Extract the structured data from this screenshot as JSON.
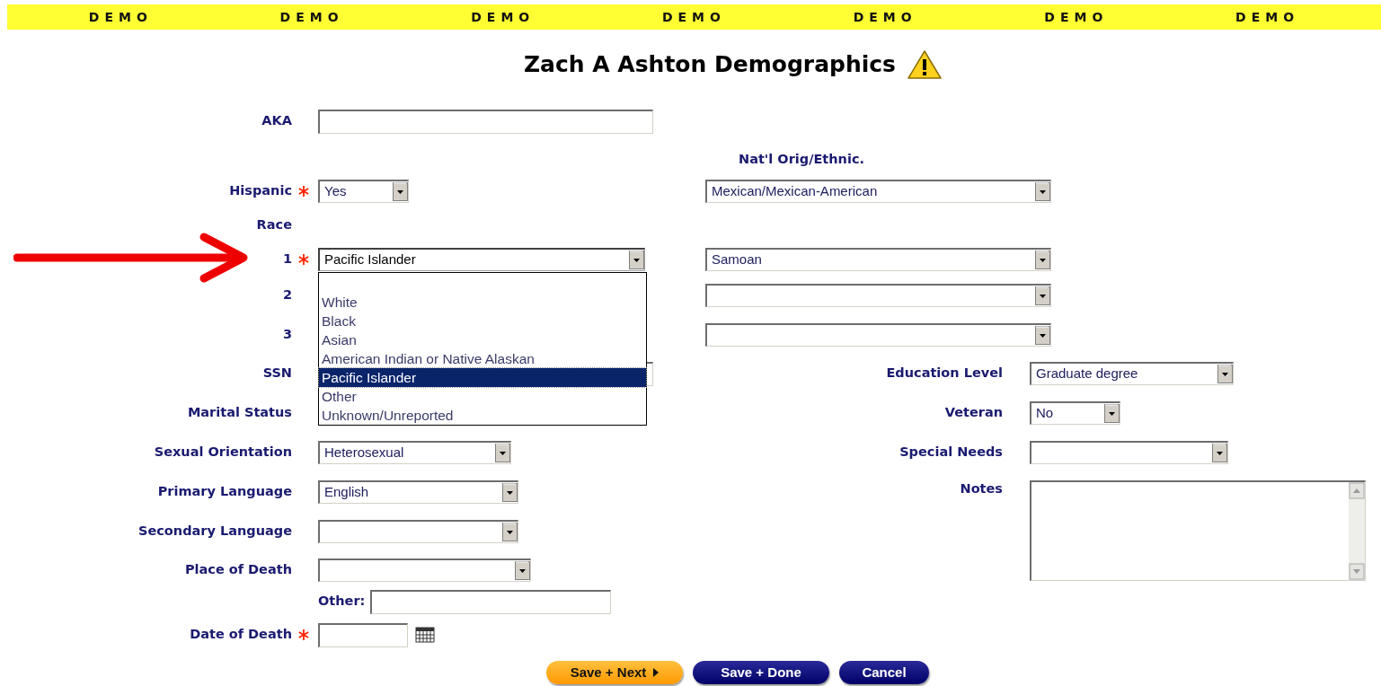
{
  "banner": [
    "DEMO",
    "DEMO",
    "DEMO",
    "DEMO",
    "DEMO",
    "DEMO",
    "DEMO"
  ],
  "title": "Zach A Ashton Demographics",
  "aka": {
    "label": "AKA"
  },
  "ethnicity_heading": "Nat'l Orig/Ethnic.",
  "hispanic": {
    "label": "Hispanic",
    "required": true,
    "value": "Yes",
    "ethnicity": "Mexican/Mexican-American"
  },
  "race": {
    "label": "Race",
    "rows": [
      {
        "number": "1",
        "required": true,
        "value": "Pacific Islander",
        "ethnicity": "Samoan",
        "expanded": true
      },
      {
        "number": "2",
        "required": false
      },
      {
        "number": "3",
        "required": false
      }
    ]
  },
  "race_options": [
    {
      "label": "White",
      "selected": false
    },
    {
      "label": "Black",
      "selected": false
    },
    {
      "label": "Asian",
      "selected": false
    },
    {
      "label": "American Indian or Native Alaskan",
      "selected": false
    },
    {
      "label": "Pacific Islander",
      "selected": true
    },
    {
      "label": "Other",
      "selected": false
    },
    {
      "label": "Unknown/Unreported",
      "selected": false
    }
  ],
  "left_fields": [
    {
      "label": "SSN",
      "kind": "text"
    },
    {
      "label": "Marital Status",
      "kind": "label"
    },
    {
      "label": "Sexual Orientation",
      "kind": "select",
      "value": "Heterosexual"
    },
    {
      "label": "Primary Language",
      "kind": "select",
      "value": "English"
    },
    {
      "label": "Secondary Language",
      "kind": "select"
    },
    {
      "label": "Place of Death",
      "kind": "select"
    },
    {
      "label": "Other:",
      "kind": "inline_text"
    },
    {
      "label": "Date of Death",
      "kind": "date",
      "required": true
    }
  ],
  "right_fields": [
    {
      "label": "Education Level",
      "kind": "select",
      "value": "Graduate degree"
    },
    {
      "label": "Veteran",
      "kind": "select",
      "value": "No"
    },
    {
      "label": "Special Needs",
      "kind": "select"
    },
    {
      "label": "Notes",
      "kind": "textarea"
    }
  ],
  "buttons": [
    {
      "label": "Save + Next",
      "kind": "next"
    },
    {
      "label": "Save + Done",
      "kind": "primary"
    },
    {
      "label": "Cancel",
      "kind": "primary"
    }
  ]
}
